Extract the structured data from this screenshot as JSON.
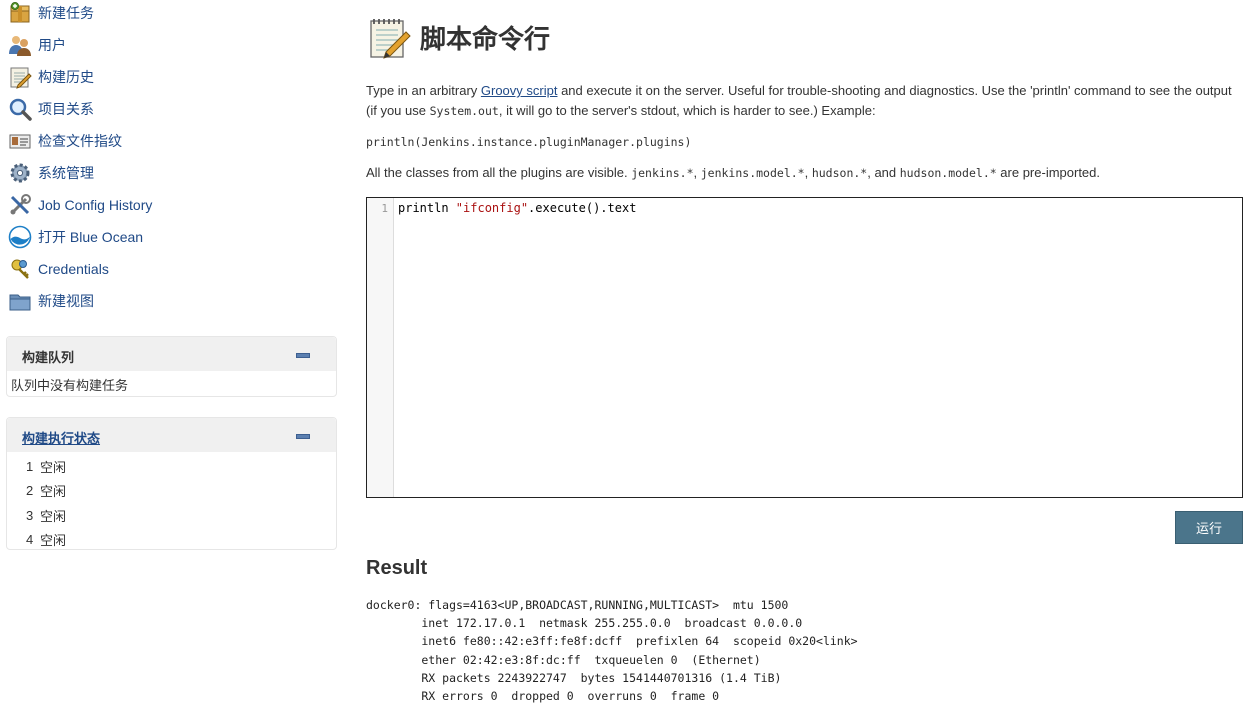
{
  "sidebar": {
    "tasks": [
      {
        "label": "新建任务",
        "icon": "new-package-icon"
      },
      {
        "label": "用户",
        "icon": "users-icon"
      },
      {
        "label": "构建历史",
        "icon": "notepad-icon"
      },
      {
        "label": "项目关系",
        "icon": "magnifier-icon"
      },
      {
        "label": "检查文件指纹",
        "icon": "fingerprint-icon"
      },
      {
        "label": "系统管理",
        "icon": "gear-icon"
      },
      {
        "label": "Job Config History",
        "icon": "config-tools-icon"
      },
      {
        "label": "打开 Blue Ocean",
        "icon": "blue-ocean-icon"
      },
      {
        "label": "Credentials",
        "icon": "credentials-icon"
      },
      {
        "label": "新建视图",
        "icon": "folder-icon"
      }
    ],
    "build_queue": {
      "title": "构建队列",
      "empty_text": "队列中没有构建任务"
    },
    "executors": {
      "title": "构建执行状态",
      "rows": [
        {
          "num": "1",
          "status": "空闲"
        },
        {
          "num": "2",
          "status": "空闲"
        },
        {
          "num": "3",
          "status": "空闲"
        },
        {
          "num": "4",
          "status": "空闲"
        }
      ]
    }
  },
  "main": {
    "title": "脚本命令行",
    "intro": {
      "part1": "Type in an arbitrary ",
      "link": "Groovy script",
      "part2": " and execute it on the server. Useful for trouble-shooting and diagnostics. Use the 'println' command to see the output (if you use ",
      "code": "System.out",
      "part3": ", it will go to the server's stdout, which is harder to see.) Example:"
    },
    "example_code": "println(Jenkins.instance.pluginManager.plugins)",
    "classes": {
      "part1": "All the classes from all the plugins are visible. ",
      "pkg1": "jenkins.*",
      "sep1": ", ",
      "pkg2": "jenkins.model.*",
      "sep2": ", ",
      "pkg3": "hudson.*",
      "sep3": ", and ",
      "pkg4": "hudson.model.*",
      "part2": " are pre-imported."
    },
    "editor": {
      "line_number": "1",
      "code_prefix": "println ",
      "code_string": "\"ifconfig\"",
      "code_suffix": ".execute().text"
    },
    "run_label": "运行",
    "result_title": "Result",
    "result_output": "docker0: flags=4163<UP,BROADCAST,RUNNING,MULTICAST>  mtu 1500\n        inet 172.17.0.1  netmask 255.255.0.0  broadcast 0.0.0.0\n        inet6 fe80::42:e3ff:fe8f:dcff  prefixlen 64  scopeid 0x20<link>\n        ether 02:42:e3:8f:dc:ff  txqueuelen 0  (Ethernet)\n        RX packets 2243922747  bytes 1541440701316 (1.4 TiB)\n        RX errors 0  dropped 0  overruns 0  frame 0"
  },
  "colors": {
    "link": "#204a87",
    "button": "#4b758b",
    "pane_header": "#f0f0f0"
  }
}
